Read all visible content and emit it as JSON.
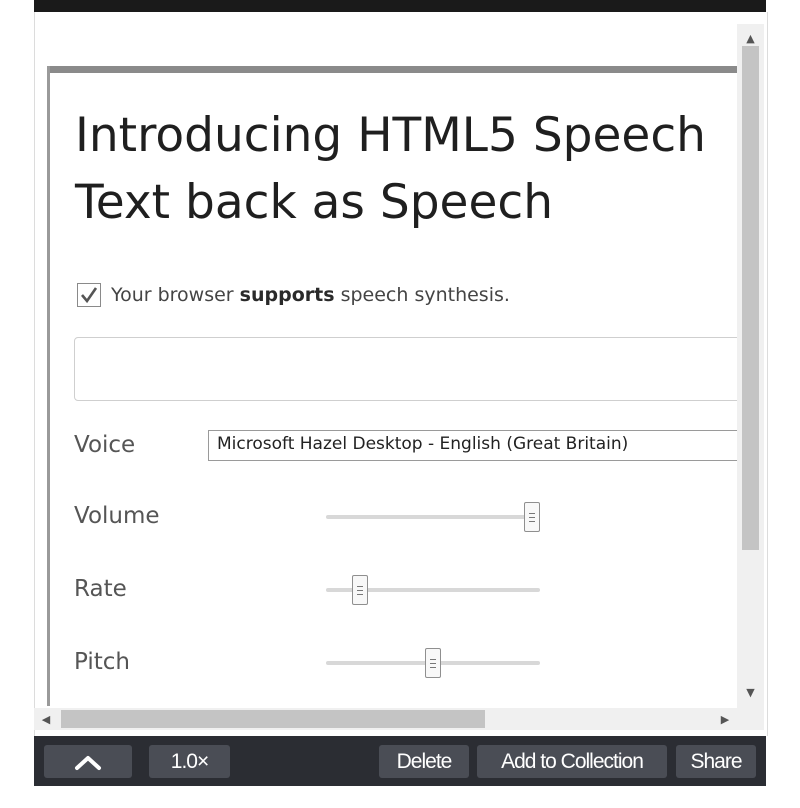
{
  "article": {
    "heading_line1": "Introducing HTML5 Speech",
    "heading_line2": "Text back as Speech",
    "support_prefix": "Your browser",
    "support_strong": "supports",
    "support_suffix": "speech synthesis.",
    "support_checked": true,
    "text_input_value": "",
    "voice_label": "Voice",
    "voice_selected": "Microsoft Hazel Desktop - English (Great Britain)",
    "volume_label": "Volume",
    "volume_value": 1.0,
    "rate_label": "Rate",
    "rate_value": 0.13,
    "pitch_label": "Pitch",
    "pitch_value": 0.5
  },
  "toolbar": {
    "collapse_icon": "chevron-up-icon",
    "speed_label": "1.0×",
    "delete_label": "Delete",
    "collection_label": "Add to Collection",
    "share_label": "Share"
  },
  "colors": {
    "toolbar_bg": "#2b2d33",
    "toolbar_button_bg": "#4a4d55",
    "heading_text": "#1f1f1f"
  }
}
